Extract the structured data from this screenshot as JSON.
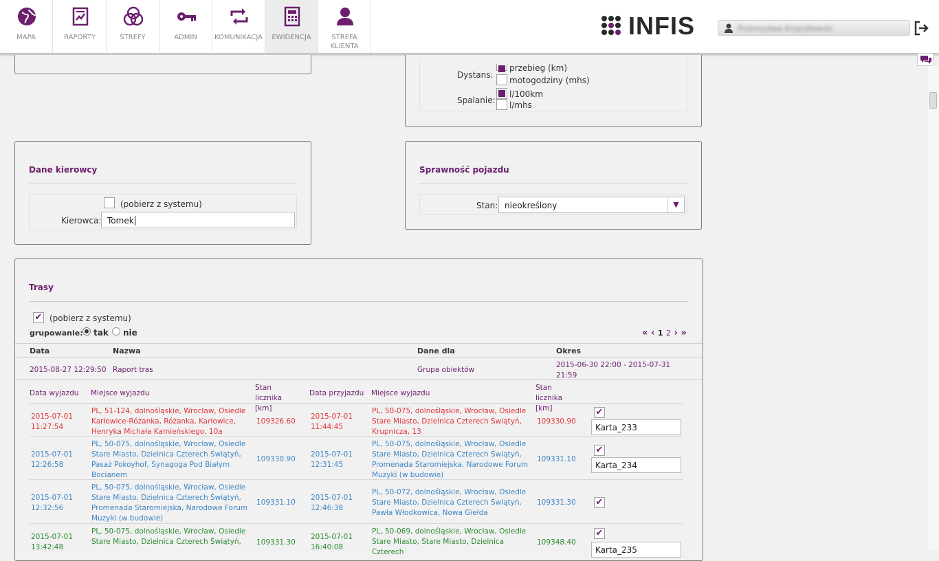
{
  "nav": {
    "tabs": [
      {
        "label": "MAPA",
        "icon": "globe-icon"
      },
      {
        "label": "RAPORTY",
        "icon": "report-icon"
      },
      {
        "label": "STREFY",
        "icon": "zones-icon"
      },
      {
        "label": "ADMIN",
        "icon": "key-icon"
      },
      {
        "label": "KOMUNIKACJA",
        "icon": "sync-icon"
      },
      {
        "label": "EWIDENCJA",
        "icon": "calculator-icon"
      },
      {
        "label": "STREFA\nKLIENTA",
        "icon": "user-icon"
      }
    ],
    "active": "EWIDENCJA"
  },
  "brand": {
    "logo": "INFIS",
    "accent": "#6b1f6e"
  },
  "user": {
    "name": "Przemysław Kropidłowski"
  },
  "units": {
    "dystans_label": "Dystans:",
    "dystans_opt1": "przebieg (km)",
    "dystans_opt2": "motogodziny (mhs)",
    "spalanie_label": "Spalanie:",
    "spalanie_opt1": "l/100km",
    "spalanie_opt2": "l/mhs"
  },
  "driver": {
    "title": "Dane kierowcy",
    "auto_label": "(pobierz z systemu)",
    "field_label": "Kierowca:",
    "value": "Tomek"
  },
  "vehicle": {
    "title": "Sprawność pojazdu",
    "stan_label": "Stan:",
    "stan_value": "nieokreślony"
  },
  "routes": {
    "title": "Trasy",
    "auto_label": "(pobierz z systemu)",
    "group_label": "grupowanie:",
    "group_yes": "tak",
    "group_no": "nie",
    "pagination": {
      "first": "«",
      "prev": "‹",
      "page1": "1",
      "page2": "2",
      "next": "›",
      "last": "»"
    },
    "headers": {
      "data": "Data",
      "nazwa": "Nazwa",
      "dane_dla": "Dane dla",
      "okres": "Okres"
    },
    "report": {
      "data": "2015-08-27 12:29:50",
      "nazwa": "Raport tras",
      "dane_dla": "Grupa obiektów",
      "okres": "2015-06-30 22:00 - 2015-07-31 21:59"
    },
    "sub_headers": {
      "data_wyjazdu": "Data wyjazdu",
      "miejsce_wyjazdu": "Miejsce wyjazdu",
      "stan_licznika": "Stan licznika [km]",
      "data_przyjazdu": "Data przyjazdu",
      "miejsce_wyjazdu2": "Miejsce wyjazdu",
      "stan_licznika2": "Stan licznika [km]"
    },
    "rows": [
      {
        "dep_date": "2015-07-01 11:27:54",
        "dep_place": "PL, 51-124, dolnośląskie, Wrocław, Osiedle Karłowice-Różanka, Różanka, Karłowice, Henryka Michała Kamieńskiego, 10a",
        "dep_odo": "109326.60",
        "arr_date": "2015-07-01 11:44:45",
        "arr_place": "PL, 50-075, dolnośląskie, Wrocław, Osiedle Stare Miasto, Dzielnica Czterech Świątyń, Krupnicza, 13",
        "arr_odo": "109330.90",
        "karta": "Karta_233",
        "color": "#e0353a"
      },
      {
        "dep_date": "2015-07-01 12:26:58",
        "dep_place": "PL, 50-075, dolnośląskie, Wrocław, Osiedle Stare Miasto, Dzielnica Czterech Świątyń, Pasaż Pokoyhof, Synagoga Pod Białym Bocianem",
        "dep_odo": "109330.90",
        "arr_date": "2015-07-01 12:31:45",
        "arr_place": "PL, 50-075, dolnośląskie, Wrocław, Osiedle Stare Miasto, Dzielnica Czterech Świątyń, Promenada Staromiejska, Narodowe Forum Muzyki (w budowie)",
        "arr_odo": "109331.10",
        "karta": "Karta_234",
        "color": "#3d86c6"
      },
      {
        "dep_date": "2015-07-01 12:32:56",
        "dep_place": "PL, 50-075, dolnośląskie, Wrocław, Osiedle Stare Miasto, Dzielnica Czterech Świątyń, Promenada Staromiejska, Narodowe Forum Muzyki (w budowie)",
        "dep_odo": "109331.10",
        "arr_date": "2015-07-01 12:46:38",
        "arr_place": "PL, 50-072, dolnośląskie, Wrocław, Osiedle Stare Miasto, Dzielnica Czterech Świątyń, Pawła Włodkowica, Nowa Giełda",
        "arr_odo": "109331.30",
        "karta": "",
        "color": "#3d86c6"
      },
      {
        "dep_date": "2015-07-01 13:42:48",
        "dep_place": "PL, 50-075, dolnośląskie, Wrocław, Osiedle Stare Miasto, Dzielnica Czterech Świątyń,",
        "dep_odo": "109331.30",
        "arr_date": "2015-07-01 16:40:08",
        "arr_place": "PL, 50-069, dolnośląskie, Wrocław, Osiedle Stare Miasto, Stare Miasto, Dzielnica Czterech",
        "arr_odo": "109348.40",
        "karta": "Karta_235",
        "color": "#2d8c32"
      }
    ]
  }
}
